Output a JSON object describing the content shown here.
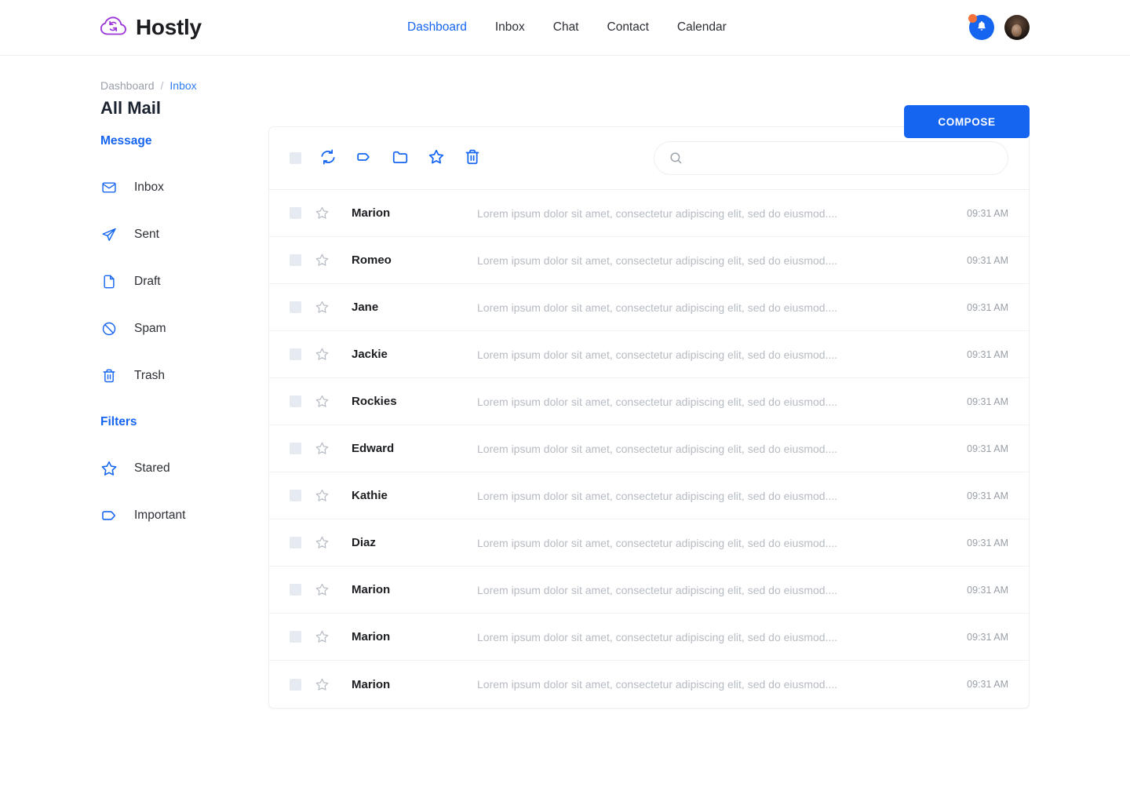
{
  "brand": {
    "name": "Hostly",
    "logo_icon": "cloud-sync-icon",
    "logo_color": "#9b34d6"
  },
  "nav": {
    "items": [
      {
        "label": "Dashboard",
        "active": true
      },
      {
        "label": "Inbox",
        "active": false
      },
      {
        "label": "Chat",
        "active": false
      },
      {
        "label": "Contact",
        "active": false
      },
      {
        "label": "Calendar",
        "active": false
      }
    ]
  },
  "header_right": {
    "notification_icon": "bell-icon",
    "notification_dot_color": "#f4733a",
    "notification_bg": "#1565f0",
    "avatar_icon": "user-avatar"
  },
  "page": {
    "breadcrumb": {
      "root": "Dashboard",
      "separator": "/",
      "current": "Inbox"
    },
    "title": "All Mail",
    "compose_label": "COMPOSE",
    "accent_color": "#1565f0"
  },
  "sidebar": {
    "message_heading": "Message",
    "message_items": [
      {
        "label": "Inbox",
        "icon": "envelope-icon"
      },
      {
        "label": "Sent",
        "icon": "paper-plane-icon"
      },
      {
        "label": "Draft",
        "icon": "file-icon"
      },
      {
        "label": "Spam",
        "icon": "ban-icon"
      },
      {
        "label": "Trash",
        "icon": "trash-icon"
      }
    ],
    "filters_heading": "Filters",
    "filter_items": [
      {
        "label": "Stared",
        "icon": "star-icon"
      },
      {
        "label": "Important",
        "icon": "tag-icon"
      }
    ]
  },
  "toolbar": {
    "select_all_icon": "checkbox-icon",
    "buttons": [
      {
        "icon": "refresh-icon"
      },
      {
        "icon": "tag-icon"
      },
      {
        "icon": "folder-icon"
      },
      {
        "icon": "star-icon"
      },
      {
        "icon": "trash-icon"
      }
    ],
    "search": {
      "icon": "search-icon",
      "value": "",
      "placeholder": ""
    }
  },
  "mail_list": {
    "rows": [
      {
        "name": "Marion",
        "preview": "Lorem ipsum dolor sit amet, consectetur adipiscing elit, sed do eiusmod....",
        "time": "09:31 AM"
      },
      {
        "name": "Romeo",
        "preview": "Lorem ipsum dolor sit amet, consectetur adipiscing elit, sed do eiusmod....",
        "time": "09:31 AM"
      },
      {
        "name": "Jane",
        "preview": "Lorem ipsum dolor sit amet, consectetur adipiscing elit, sed do eiusmod....",
        "time": "09:31 AM"
      },
      {
        "name": "Jackie",
        "preview": "Lorem ipsum dolor sit amet, consectetur adipiscing elit, sed do eiusmod....",
        "time": "09:31 AM"
      },
      {
        "name": "Rockies",
        "preview": "Lorem ipsum dolor sit amet, consectetur adipiscing elit, sed do eiusmod....",
        "time": "09:31 AM"
      },
      {
        "name": "Edward",
        "preview": "Lorem ipsum dolor sit amet, consectetur adipiscing elit, sed do eiusmod....",
        "time": "09:31 AM"
      },
      {
        "name": "Kathie",
        "preview": "Lorem ipsum dolor sit amet, consectetur adipiscing elit, sed do eiusmod....",
        "time": "09:31 AM"
      },
      {
        "name": "Diaz",
        "preview": "Lorem ipsum dolor sit amet, consectetur adipiscing elit, sed do eiusmod....",
        "time": "09:31 AM"
      },
      {
        "name": "Marion",
        "preview": "Lorem ipsum dolor sit amet, consectetur adipiscing elit, sed do eiusmod....",
        "time": "09:31 AM"
      },
      {
        "name": "Marion",
        "preview": "Lorem ipsum dolor sit amet, consectetur adipiscing elit, sed do eiusmod....",
        "time": "09:31 AM"
      },
      {
        "name": "Marion",
        "preview": "Lorem ipsum dolor sit amet, consectetur adipiscing elit, sed do eiusmod....",
        "time": "09:31 AM"
      }
    ]
  }
}
